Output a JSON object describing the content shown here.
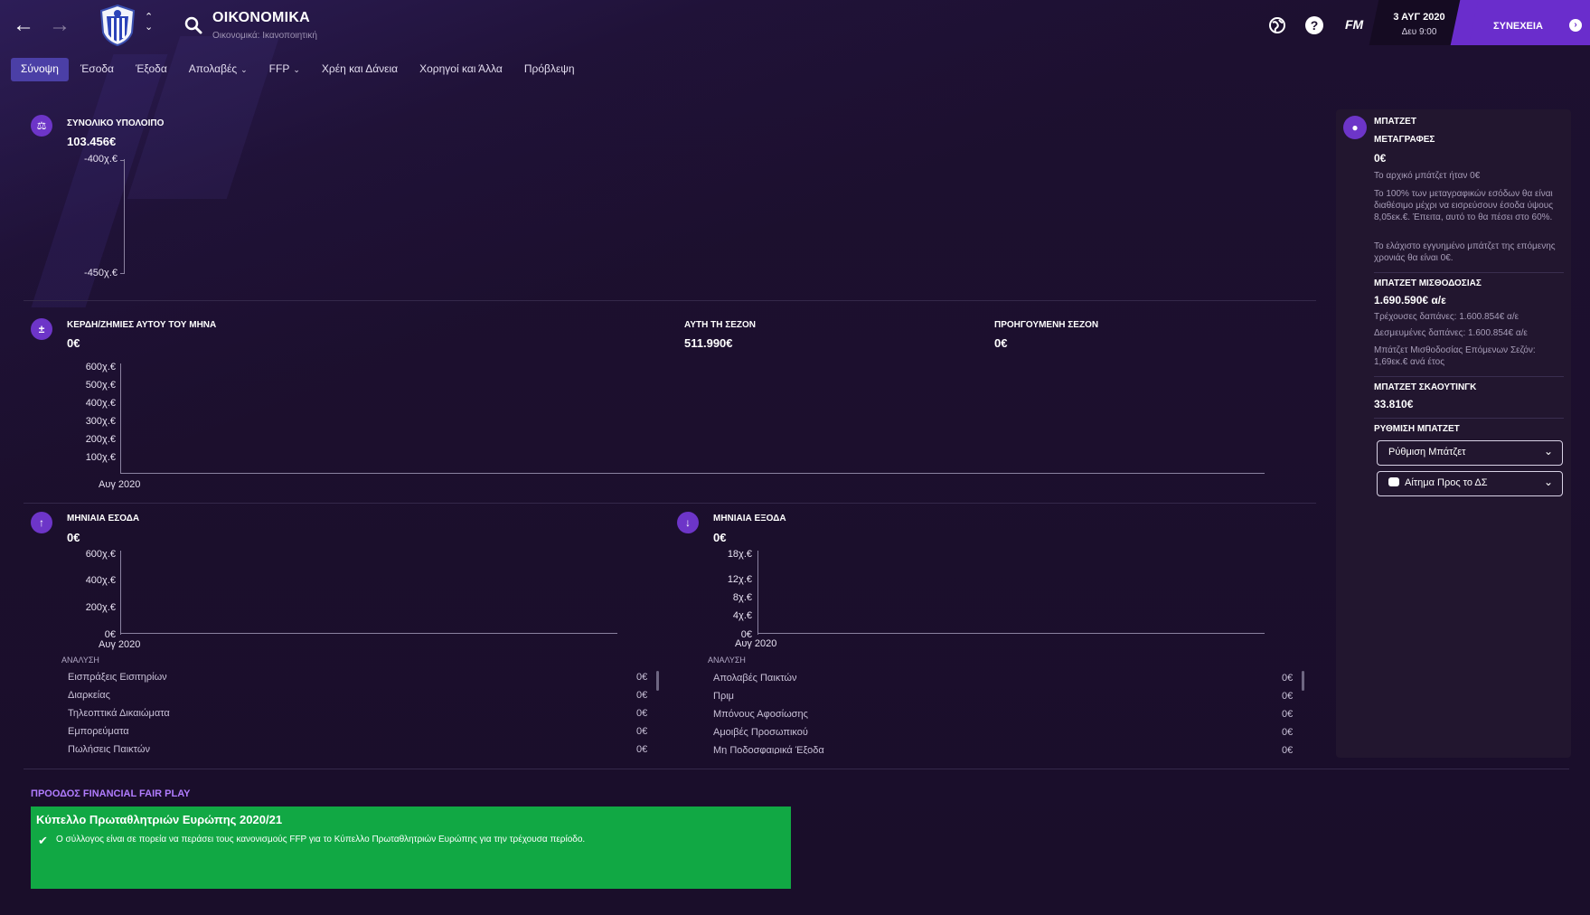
{
  "header": {
    "title": "ΟΙΚΟΝΟΜΙΚΑ",
    "subtitle": "Οικονομικά: Ικανοποιητική",
    "fm_logo": "FM",
    "date": "3 ΑΥΓ 2020",
    "date_sub": "Δευ 9:00",
    "continue_label": "ΣΥΝΕΧΕΙΑ"
  },
  "tabs": [
    {
      "label": "Σύνοψη",
      "active": true
    },
    {
      "label": "Έσοδα"
    },
    {
      "label": "Έξοδα"
    },
    {
      "label": "Απολαβές",
      "dropdown": true
    },
    {
      "label": "FFP",
      "dropdown": true
    },
    {
      "label": "Χρέη και Δάνεια"
    },
    {
      "label": "Χορηγοί και Άλλα"
    },
    {
      "label": "Πρόβλεψη"
    }
  ],
  "balance": {
    "title": "ΣΥΝΟΛΙΚΟ ΥΠΟΛΟΙΠΟ",
    "value": "103.456€",
    "y_ticks": [
      "-400χ.€",
      "-450χ.€"
    ]
  },
  "profit": {
    "title": "ΚΕΡΔΗ/ΖΗΜΙΕΣ ΑΥΤΟΥ ΤΟΥ ΜΗΝΑ",
    "value": "0€",
    "season_title": "ΑΥΤΗ ΤΗ ΣΕΖΟΝ",
    "season_value": "511.990€",
    "prev_title": "ΠΡΟΗΓΟΥΜΕΝΗ ΣΕΖΟΝ",
    "prev_value": "0€",
    "y_ticks": [
      "600χ.€",
      "500χ.€",
      "400χ.€",
      "300χ.€",
      "200χ.€",
      "100χ.€"
    ],
    "x_label": "Αυγ 2020"
  },
  "income": {
    "title": "ΜΗΝΙΑΙΑ ΕΣΟΔΑ",
    "value": "0€",
    "y_ticks": [
      "600χ.€",
      "400χ.€",
      "200χ.€",
      "0€"
    ],
    "x_label": "Αυγ 2020",
    "breakdown_title": "ΑΝΑΛΥΣΗ",
    "rows": [
      {
        "name": "Εισπράξεις Εισιτηρίων",
        "value": "0€"
      },
      {
        "name": "Διαρκείας",
        "value": "0€"
      },
      {
        "name": "Τηλεοπτικά Δικαιώματα",
        "value": "0€"
      },
      {
        "name": "Εμπορεύματα",
        "value": "0€"
      },
      {
        "name": "Πωλήσεις Παικτών",
        "value": "0€"
      }
    ]
  },
  "expenses": {
    "title": "ΜΗΝΙΑΙΑ ΕΞΟΔΑ",
    "value": "0€",
    "y_ticks": [
      "18χ.€",
      "12χ.€",
      "8χ.€",
      "4χ.€",
      "0€"
    ],
    "x_label": "Αυγ 2020",
    "breakdown_title": "ΑΝΑΛΥΣΗ",
    "rows": [
      {
        "name": "Απολαβές Παικτών",
        "value": "0€"
      },
      {
        "name": "Πριμ",
        "value": "0€"
      },
      {
        "name": "Μπόνους Αφοσίωσης",
        "value": "0€"
      },
      {
        "name": "Αμοιβές Προσωπικού",
        "value": "0€"
      },
      {
        "name": "Μη Ποδοσφαιρικά Έξοδα",
        "value": "0€"
      }
    ]
  },
  "budget": {
    "title": "ΜΠΑΤΖΕΤ",
    "transfers_title": "ΜΕΤΑΓΡΑΦΕΣ",
    "transfers_value": "0€",
    "transfers_note1": "Το αρχικό μπάτζετ ήταν 0€",
    "transfers_note2": "Το 100% των μεταγραφικών εσόδων θα είναι διαθέσιμο μέχρι να εισρεύσουν έσοδα ύψους 8,05εκ.€. Έπειτα, αυτό το θα πέσει στο 60%.",
    "transfers_note3": "Το ελάχιστο εγγυημένο μπάτζετ της επόμενης χρονιάς θα είναι 0€.",
    "wage_title": "ΜΠΑΤΖΕΤ ΜΙΣΘΟΔΟΣΙΑΣ",
    "wage_value": "1.690.590€ α/ε",
    "wage_current": "Τρέχουσες δαπάνες: 1.600.854€ α/ε",
    "wage_committed": "Δεσμευμένες δαπάνες: 1.600.854€ α/ε",
    "wage_next": "Μπάτζετ Μισθοδοσίας Επόμενων Σεζόν: 1,69εκ.€ ανά έτος",
    "scouting_title": "ΜΠΑΤΖΕΤ ΣΚΑΟΥΤΙΝΓΚ",
    "scouting_value": "33.810€",
    "settings_title": "ΡΥΘΜΙΣΗ ΜΠΑΤΖΕΤ",
    "dropdown1": "Ρύθμιση Μπάτζετ",
    "dropdown2": "Αίτημα Προς το ΔΣ"
  },
  "ffp": {
    "heading": "ΠΡΟΟΔΟΣ FINANCIAL FAIR PLAY",
    "box_title": "Κύπελλο Πρωταθλητριών Ευρώπης 2020/21",
    "box_text": "Ο σύλλογος είναι σε πορεία να περάσει τους κανονισμούς FFP για το Κύπελλο Πρωταθλητριών Ευρώπης για την τρέχουσα περίοδο."
  }
}
